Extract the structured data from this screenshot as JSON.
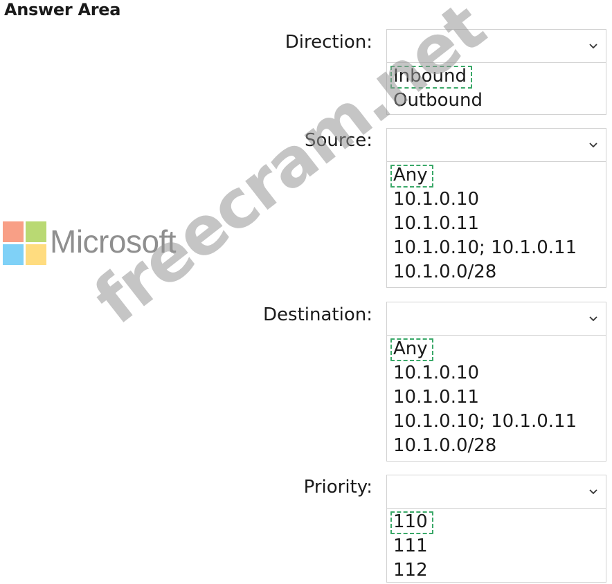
{
  "title": "Answer Area",
  "brand": {
    "name": "Microsoft",
    "colors": [
      "#f25022",
      "#7fba00",
      "#00a4ef",
      "#ffb900"
    ]
  },
  "watermark": "freecram.net",
  "fields": [
    {
      "label": "Direction:",
      "options": [
        "Inbound",
        "Outbound"
      ],
      "selected_index": 0
    },
    {
      "label": "Source:",
      "options": [
        "Any",
        "10.1.0.10",
        "10.1.0.11",
        "10.1.0.10; 10.1.0.11",
        "10.1.0.0/28"
      ],
      "selected_index": 0
    },
    {
      "label": "Destination:",
      "options": [
        "Any",
        "10.1.0.10",
        "10.1.0.11",
        "10.1.0.10; 10.1.0.11",
        "10.1.0.0/28"
      ],
      "selected_index": 0
    },
    {
      "label": "Priority:",
      "options": [
        "110",
        "111",
        "112"
      ],
      "selected_index": 0
    }
  ],
  "selection_color": "#3aa868"
}
